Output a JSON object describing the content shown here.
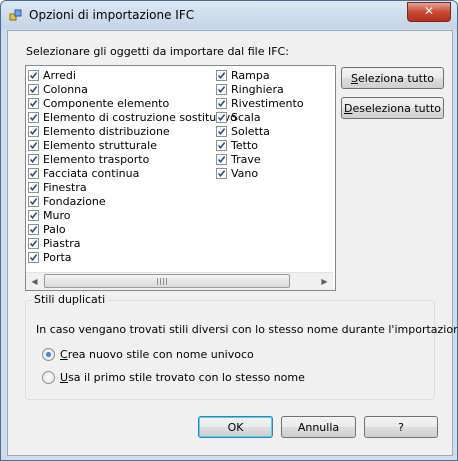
{
  "window": {
    "title": "Opzioni di importazione IFC",
    "close_glyph": "✕"
  },
  "prompt": "Selezionare gli oggetti da importare dal file IFC:",
  "list": {
    "column1": [
      {
        "label": "Arredi",
        "checked": true
      },
      {
        "label": "Colonna",
        "checked": true
      },
      {
        "label": "Componente elemento",
        "checked": true
      },
      {
        "label": "Elemento di costruzione sostitutivo",
        "checked": true
      },
      {
        "label": "Elemento distribuzione",
        "checked": true
      },
      {
        "label": "Elemento strutturale",
        "checked": true
      },
      {
        "label": "Elemento trasporto",
        "checked": true
      },
      {
        "label": "Facciata continua",
        "checked": true
      },
      {
        "label": "Finestra",
        "checked": true
      },
      {
        "label": "Fondazione",
        "checked": true
      },
      {
        "label": "Muro",
        "checked": true
      },
      {
        "label": "Palo",
        "checked": true
      },
      {
        "label": "Piastra",
        "checked": true
      },
      {
        "label": "Porta",
        "checked": true
      }
    ],
    "column2": [
      {
        "label": "Rampa",
        "checked": true
      },
      {
        "label": "Ringhiera",
        "checked": true
      },
      {
        "label": "Rivestimento",
        "checked": true
      },
      {
        "label": "Scala",
        "checked": true
      },
      {
        "label": "Soletta",
        "checked": true
      },
      {
        "label": "Tetto",
        "checked": true
      },
      {
        "label": "Trave",
        "checked": true
      },
      {
        "label": "Vano",
        "checked": true
      }
    ],
    "scroll_left_glyph": "◀",
    "scroll_right_glyph": "▶"
  },
  "buttons": {
    "select_all": "Seleziona tutto",
    "deselect_all": "Deseleziona tutto",
    "ok": "OK",
    "cancel": "Annulla",
    "help": "?"
  },
  "group": {
    "label": "Stili duplicati",
    "text": "In caso vengano trovati stili diversi con lo stesso nome durante l'importazione:",
    "option1": "Crea nuovo stile con nome univoco",
    "option2": "Usa il primo stile trovato con lo stesso nome",
    "selected": 1
  },
  "colors": {
    "check": "#2a4d8a",
    "frame": "#cfdcea"
  }
}
